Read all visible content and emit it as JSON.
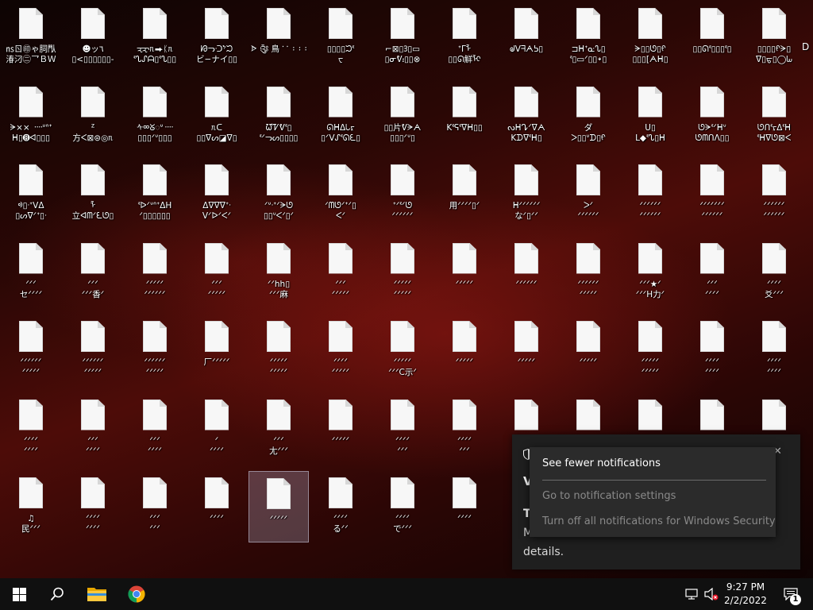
{
  "desktop": {
    "icons": [
      {
        "label": "㎱ㄖ㊞ゃ䏤閄\n​湷汈㊁乛ＢＷ",
        "selected": false
      },
      {
        "label": "☻ッ٦\n▯<▯▯▯▯▯▯-",
        "selected": false
      },
      {
        "label": "ᠽᠽᥰ⮕ᛕᥰ\nᓫᔐᔑᗩ▯ᓫᔐ▯▯",
        "selected": false
      },
      {
        "label": "ᘙᓓᑝᖮᙂ\nビ−ナイ▯▯",
        "selected": false
      },
      {
        "label": "ᗌ ༂ 鳥 ་ ་ ᠄ ᠄ ᠄",
        "selected": false
      },
      {
        "label": "▯▯▯▯ᙂᓫ\nᠸ",
        "selected": false
      },
      {
        "label": "⌐⊠▯ᢃ▯▭\n▯ᓂᕓ᎓▯▯⊗",
        "selected": false
      },
      {
        "label": "ᐩᒥᠯ\n▯▯ᘏ觧ᠯᢈ",
        "selected": false
      },
      {
        "label": "ᖙᐯᖷᗅᕊ▯",
        "selected": false
      },
      {
        "label": "⊐ᕼᐩᓌᔐ▯\nᓫ▯▭ᐟ▯▯᛭▯",
        "selected": false
      },
      {
        "label": "ᗒ▯▯ᘎ▯ᠻ\n▯▯▯[ᗅᕼ▯",
        "selected": false
      },
      {
        "label": "▯▯ᘏᓫ▯▯▯ᓫ▯",
        "selected": false
      },
      {
        "label": "▯▯▯▯ᠻᗒ▯\nᐁ▯ᠳ▯◯ᘈ",
        "selected": false
      },
      {
        "label": "ᗒ×× ᠁ᐡᐢᐩ\nᕼ▯➑ᐊ▯▯▯",
        "selected": false
      },
      {
        "label": "ᙆ\n方ᐸ⊠⊜◎ᥰ",
        "selected": false
      },
      {
        "label": "ᠰᢁᘜᢆᢆᢆᐡ᠁\n▯▯▯ᐟᐡ▯▯▯",
        "selected": false
      },
      {
        "label": "ᥰᑕ\n▯▯ᐁᔕ◪ᐁ▯",
        "selected": false
      },
      {
        "label": "ᘺᏤᕓᓫ▯\nᓫᐟᓓᔕ▯▯▯▯",
        "selected": false
      },
      {
        "label": "ᘏᕼᐃᘂᠷ\n▯ᐟᐯᔑᓫᘏᘍ▯",
        "selected": false
      },
      {
        "label": "▯▯片ᕓᗒᗅ\n▯▯▯ᐟᐡ▯",
        "selected": false
      },
      {
        "label": "Kᓫᕌᓫᐁᕼ▯▯",
        "selected": false
      },
      {
        "label": "ᔓᕼᖊᐟᐁᗅ\nKᗪᐁᓫᕼ▯",
        "selected": false
      },
      {
        "label": "ダ\nᐳ▯▯ᐡᗪ▯ᠻ",
        "selected": false
      },
      {
        "label": "ᑌ▯\nᒪ◆ᓫᔐ▯ᕼ",
        "selected": false
      },
      {
        "label": "ᘎᗒᓫᐟᕼᐡ\nᘎᗰᑎᐱ▯▯",
        "selected": false
      },
      {
        "label": "ᘎᑎᓫᠷᐃᓫᕼ\nᓫᕼᐁᘎ⊠ᐸ",
        "selected": false
      },
      {
        "label": "ᢀ▯ᐧᐩᐯᐃ\n▯ᔕᐁᐟᐩ▯ᐧ",
        "selected": false
      },
      {
        "label": "ᠯ\n立ᐊᗰᐟᘍᘎ▯",
        "selected": false
      },
      {
        "label": "ᓫᐅᐟᐡᐢᐩᐃH\nᐟ▯▯▯▯▯▯",
        "selected": false
      },
      {
        "label": "ᐃᐁᐁᐁᐩᐧ\nᐯᐟᐅᐟᐸᐟ",
        "selected": false
      },
      {
        "label": "ᐟᐡᐧᐩᐟᗒᘎ\n▯▯ᐡᐸᐟ▯ᐟ",
        "selected": false
      },
      {
        "label": "ᐟᗰᘎᐟᐩᐟ▯\nᐸᐟ",
        "selected": false
      },
      {
        "label": "ᐩᐟᓫᐟᘎ\nᐟᐟᐟᐟᐟᐟ",
        "selected": false
      },
      {
        "label": "用ᐟᐟᐟᐟ▯ᐟ",
        "selected": false
      },
      {
        "label": "ᕼᐟᐟᐟᐟᐟᐟ\nなᐟ▯ᐟᐟ",
        "selected": false
      },
      {
        "label": "ᐳᐟ\nᐟᐟᐟᐟᐟᐟ",
        "selected": false
      },
      {
        "label": "ᐟᐟᐟᐟᐟᐟ\nᐟᐟᐟᐟᐟᐟ",
        "selected": false
      },
      {
        "label": "ᐟᐟᐟᐟᐟᐟᐟ\nᐟᐟᐟᐟᐟᐟ",
        "selected": false
      },
      {
        "label": "ᐟᐟᐟᐟᐟᐟ\nᐟᐟᐟᐟᐟᐟ",
        "selected": false
      },
      {
        "label": "ᐟᐟᐟ\nセᐟᐟᐟᐟ",
        "selected": false
      },
      {
        "label": "ᐟᐟᐟ\nᐟᐟᐟ香ᐟ",
        "selected": false
      },
      {
        "label": "ᐟᐟᐟᐟᐟ\nᐟᐟᐟᐟᐟᐟ",
        "selected": false
      },
      {
        "label": "ᐟᐟᐟ\nᐟᐟᐟᐟᐟ",
        "selected": false
      },
      {
        "label": "ᐟᐟhh▯\nᐟᐟᐟ麻",
        "selected": false
      },
      {
        "label": "ᐟᐟᐟ\nᐟᐟᐟᐟᐟ",
        "selected": false
      },
      {
        "label": "ᐟᐟᐟᐟᐟ\nᐟᐟᐟᐟᐟ",
        "selected": false
      },
      {
        "label": "ᐟᐟᐟᐟᐟ",
        "selected": false
      },
      {
        "label": "ᐟᐟᐟᐟᐟᐟ",
        "selected": false
      },
      {
        "label": "ᐟᐟᐟᐟᐟᐟ\nᐟᐟᐟᐟᐟ",
        "selected": false
      },
      {
        "label": "ᐟᐟᐟ★ᐟ\nᐟᐟᐟH力ᐟ",
        "selected": false
      },
      {
        "label": "ᐟᐟᐟ\nᐟᐟᐟᐟ",
        "selected": false
      },
      {
        "label": "ᐟᐟᐟᐟ\n爻ᐟᐟᐟ",
        "selected": false
      },
      {
        "label": "ᐟᐟᐟᐟᐟᐟ\nᐟᐟᐟᐟᐟ",
        "selected": false
      },
      {
        "label": "ᐟᐟᐟᐟᐟᐟ\nᐟᐟᐟᐟᐟ",
        "selected": false
      },
      {
        "label": "ᐟᐟᐟᐟᐟᐟ\nᐟᐟᐟᐟᐟ",
        "selected": false
      },
      {
        "label": "厂ᐟᐟᐟᐟᐟ",
        "selected": false
      },
      {
        "label": "ᐟᐟᐟᐟᐟ\nᐟᐟᐟᐟᐟ",
        "selected": false
      },
      {
        "label": "ᐟᐟᐟᐟ\nᐟᐟᐟᐟᐟ",
        "selected": false
      },
      {
        "label": "ᐟᐟᐟᐟᐟ\nᐟᐟᐟC示ᐟ",
        "selected": false
      },
      {
        "label": "ᐟᐟᐟᐟᐟ",
        "selected": false
      },
      {
        "label": "ᐟᐟᐟᐟᐟ",
        "selected": false
      },
      {
        "label": "ᐟᐟᐟᐟᐟ",
        "selected": false
      },
      {
        "label": "ᐟᐟᐟᐟᐟ\nᐟᐟᐟᐟᐟ",
        "selected": false
      },
      {
        "label": "ᐟᐟᐟᐟ\nᐟᐟᐟᐟ",
        "selected": false
      },
      {
        "label": "ᐟᐟᐟᐟ\nᐟᐟᐟᐟ",
        "selected": false
      },
      {
        "label": "ᐟᐟᐟᐟ\nᐟᐟᐟᐟ",
        "selected": false
      },
      {
        "label": "ᐟᐟᐟ\nᐟᐟᐟᐟ",
        "selected": false
      },
      {
        "label": "ᐟᐟᐟ\nᐟᐟᐟᐟ",
        "selected": false
      },
      {
        "label": "ᐟ\nᐟᐟᐟᐟ",
        "selected": false
      },
      {
        "label": "ᐟᐟᐟ\n尢ᐟᐟᐟ",
        "selected": false
      },
      {
        "label": "ᐟᐟᐟᐟᐟ",
        "selected": false
      },
      {
        "label": "ᐟᐟᐟᐟ\nᐟᐟᐟ",
        "selected": false
      },
      {
        "label": "ᐟᐟᐟᐟ\nᐟᐟᐟ",
        "selected": false
      },
      {
        "label": "",
        "selected": false
      },
      {
        "label": "",
        "selected": false
      },
      {
        "label": "",
        "selected": false
      },
      {
        "label": "",
        "selected": false
      },
      {
        "label": "",
        "selected": false
      },
      {
        "label": "♫\n民ᐟᐟᐟ",
        "selected": false
      },
      {
        "label": "ᐟᐟᐟᐟ\nᐟᐟᐟᐟ",
        "selected": false
      },
      {
        "label": "ᐟᐟᐟ\nᐟᐟᐟ",
        "selected": false
      },
      {
        "label": "ᐟᐟᐟᐟ",
        "selected": false
      },
      {
        "label": "ᐟᐟᐟᐟᐟ",
        "selected": true
      },
      {
        "label": "ᐟᐟᐟᐟ\nるᐟᐟ",
        "selected": false
      },
      {
        "label": "ᐟᐟᐟᐟ\nでᐟᐟᐟ",
        "selected": false
      },
      {
        "label": "ᐟᐟᐟᐟ",
        "selected": false
      },
      {
        "label": "ᐟᐟᐟ\nズᐟ",
        "selected": false
      }
    ]
  },
  "toast": {
    "title": "V",
    "body_first": "Tl",
    "body_second": "M",
    "body_third": "details."
  },
  "context_menu": {
    "item_fewer": "See fewer notifications",
    "item_settings": "Go to notification settings",
    "item_turn_off": "Turn off all notifications for Windows Security"
  },
  "taskbar": {
    "time": "9:27 PM",
    "date": "2/2/2022",
    "notification_count": "1"
  }
}
